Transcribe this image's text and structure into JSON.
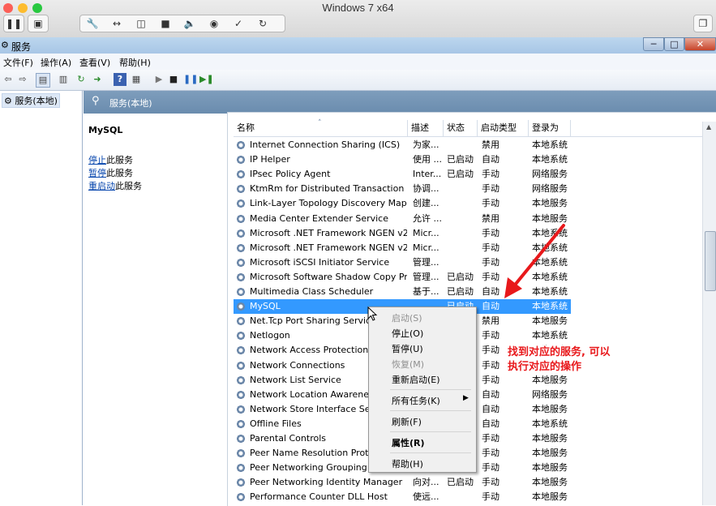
{
  "host": {
    "title": "Windows 7 x64"
  },
  "window": {
    "title": "服务"
  },
  "menu": [
    "文件(F)",
    "操作(A)",
    "查看(V)",
    "帮助(H)"
  ],
  "tree": {
    "item": "服务(本地)"
  },
  "content_header": "服务(本地)",
  "left_pane": {
    "service_name": "MySQL",
    "actions": [
      {
        "link": "停止",
        "rest": "此服务"
      },
      {
        "link": "暂停",
        "rest": "此服务"
      },
      {
        "link": "重启动",
        "rest": "此服务"
      }
    ]
  },
  "columns": [
    "名称",
    "描述",
    "状态",
    "启动类型",
    "登录为"
  ],
  "rows": [
    {
      "name": "Internet Connection Sharing (ICS)",
      "desc": "为家...",
      "status": "",
      "startup": "禁用",
      "logon": "本地系统"
    },
    {
      "name": "IP Helper",
      "desc": "使用 ...",
      "status": "已启动",
      "startup": "自动",
      "logon": "本地系统"
    },
    {
      "name": "IPsec Policy Agent",
      "desc": "Inter...",
      "status": "已启动",
      "startup": "手动",
      "logon": "网络服务"
    },
    {
      "name": "KtmRm for Distributed Transaction C...",
      "desc": "协调...",
      "status": "",
      "startup": "手动",
      "logon": "网络服务"
    },
    {
      "name": "Link-Layer Topology Discovery Map...",
      "desc": "创建...",
      "status": "",
      "startup": "手动",
      "logon": "本地服务"
    },
    {
      "name": "Media Center Extender Service",
      "desc": "允许 ...",
      "status": "",
      "startup": "禁用",
      "logon": "本地服务"
    },
    {
      "name": "Microsoft .NET Framework NGEN v2....",
      "desc": "Micr...",
      "status": "",
      "startup": "手动",
      "logon": "本地系统"
    },
    {
      "name": "Microsoft .NET Framework NGEN v2....",
      "desc": "Micr...",
      "status": "",
      "startup": "手动",
      "logon": "本地系统"
    },
    {
      "name": "Microsoft iSCSI Initiator Service",
      "desc": "管理...",
      "status": "",
      "startup": "手动",
      "logon": "本地系统"
    },
    {
      "name": "Microsoft Software Shadow Copy Pr...",
      "desc": "管理...",
      "status": "已启动",
      "startup": "手动",
      "logon": "本地系统"
    },
    {
      "name": "Multimedia Class Scheduler",
      "desc": "基于...",
      "status": "已启动",
      "startup": "自动",
      "logon": "本地系统"
    },
    {
      "name": "MySQL",
      "desc": "",
      "status": "已启动",
      "startup": "自动",
      "logon": "本地系统"
    },
    {
      "name": "Net.Tcp Port Sharing Service",
      "desc": "",
      "status": "",
      "startup": "禁用",
      "logon": "本地服务"
    },
    {
      "name": "Netlogon",
      "desc": "",
      "status": "",
      "startup": "手动",
      "logon": "本地系统"
    },
    {
      "name": "Network Access Protection A",
      "desc": "",
      "status": "",
      "startup": "手动",
      "logon": "网络服务"
    },
    {
      "name": "Network Connections",
      "desc": "",
      "status": "",
      "startup": "手动",
      "logon": "本地系统"
    },
    {
      "name": "Network List Service",
      "desc": "",
      "status": "",
      "startup": "手动",
      "logon": "本地服务"
    },
    {
      "name": "Network Location Awareness",
      "desc": "",
      "status": "",
      "startup": "自动",
      "logon": "网络服务"
    },
    {
      "name": "Network Store Interface Serv",
      "desc": "",
      "status": "",
      "startup": "自动",
      "logon": "本地服务"
    },
    {
      "name": "Offline Files",
      "desc": "",
      "status": "",
      "startup": "自动",
      "logon": "本地系统"
    },
    {
      "name": "Parental Controls",
      "desc": "",
      "status": "",
      "startup": "手动",
      "logon": "本地服务"
    },
    {
      "name": "Peer Name Resolution Proto",
      "desc": "",
      "status": "",
      "startup": "手动",
      "logon": "本地服务"
    },
    {
      "name": "Peer Networking Grouping",
      "desc": "",
      "status": "",
      "startup": "手动",
      "logon": "本地服务"
    },
    {
      "name": "Peer Networking Identity Manager",
      "desc": "向对...",
      "status": "已启动",
      "startup": "手动",
      "logon": "本地服务"
    },
    {
      "name": "Performance Counter DLL Host",
      "desc": "使远...",
      "status": "",
      "startup": "手动",
      "logon": "本地服务"
    }
  ],
  "context_menu": [
    {
      "label": "启动(S)",
      "disabled": true
    },
    {
      "label": "停止(O)",
      "disabled": false
    },
    {
      "label": "暂停(U)",
      "disabled": false
    },
    {
      "label": "恢复(M)",
      "disabled": true
    },
    {
      "label": "重新启动(E)",
      "disabled": false
    },
    {
      "label": "所有任务(K)",
      "disabled": false
    },
    {
      "label": "刷新(F)",
      "disabled": false
    },
    {
      "label": "属性(R)",
      "disabled": false
    },
    {
      "label": "帮助(H)",
      "disabled": false
    }
  ],
  "annotation": {
    "line1": "找到对应的服务, 可以",
    "line2": "执行对应的操作"
  },
  "colors": {
    "selection": "#3399ff",
    "annotation": "#e8181b",
    "header": "#7e9dbc"
  }
}
